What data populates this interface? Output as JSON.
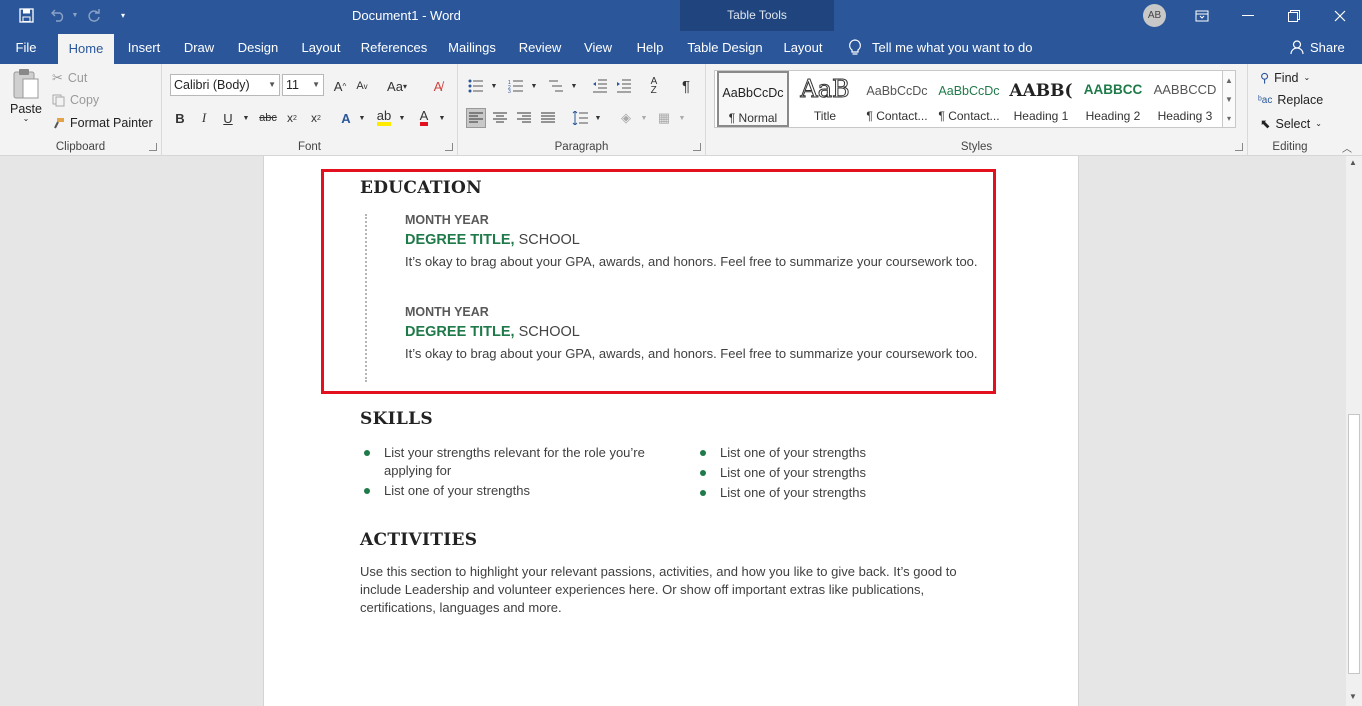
{
  "app": {
    "doc_title": "Document1 - Word",
    "table_tools": "Table Tools",
    "avatar": "AB"
  },
  "tabs": [
    "File",
    "Home",
    "Insert",
    "Draw",
    "Design",
    "Layout",
    "References",
    "Mailings",
    "Review",
    "View",
    "Help",
    "Table Design",
    "Layout"
  ],
  "tell_me": "Tell me what you want to do",
  "share": "Share",
  "clipboard": {
    "paste": "Paste",
    "cut": "Cut",
    "copy": "Copy",
    "format_painter": "Format Painter",
    "label": "Clipboard"
  },
  "font": {
    "name": "Calibri (Body)",
    "size": "11",
    "label": "Font"
  },
  "paragraph": {
    "label": "Paragraph"
  },
  "styles": {
    "label": "Styles",
    "items": [
      {
        "preview": "AaBbCcDc",
        "name": "¶ Normal"
      },
      {
        "preview": "AaB",
        "name": "Title"
      },
      {
        "preview": "AaBbCcDc",
        "name": "¶ Contact..."
      },
      {
        "preview": "AaBbCcDc",
        "name": "¶ Contact..."
      },
      {
        "preview": "AABB(",
        "name": "Heading 1"
      },
      {
        "preview": "AABBCC",
        "name": "Heading 2"
      },
      {
        "preview": "AABBCCD",
        "name": "Heading 3"
      }
    ]
  },
  "editing": {
    "find": "Find",
    "replace": "Replace",
    "select": "Select",
    "label": "Editing"
  },
  "document": {
    "education": {
      "heading": "EDUCATION",
      "entries": [
        {
          "date": "MONTH YEAR",
          "degree": "DEGREE TITLE,",
          "school": " SCHOOL",
          "text": "It’s okay to brag about your GPA, awards, and honors. Feel free to summarize your coursework too."
        },
        {
          "date": "MONTH YEAR",
          "degree": "DEGREE TITLE,",
          "school": " SCHOOL",
          "text": "It’s okay to brag about your GPA, awards, and honors. Feel free to summarize your coursework too."
        }
      ]
    },
    "skills": {
      "heading": "SKILLS",
      "left": [
        "List your strengths relevant for the role you’re applying for",
        "List one of your strengths"
      ],
      "right": [
        "List one of your strengths",
        "List one of your strengths",
        "List one of your strengths"
      ]
    },
    "activities": {
      "heading": "ACTIVITIES",
      "text": "Use this section to highlight your relevant passions, activities, and how you like to give back. It’s good to include Leadership and volunteer experiences here. Or show off important extras like publications, certifications, languages and more."
    }
  },
  "colors": {
    "brand": "#2b579a",
    "accent": "#1f7a4a",
    "selection": "#e3111d"
  }
}
